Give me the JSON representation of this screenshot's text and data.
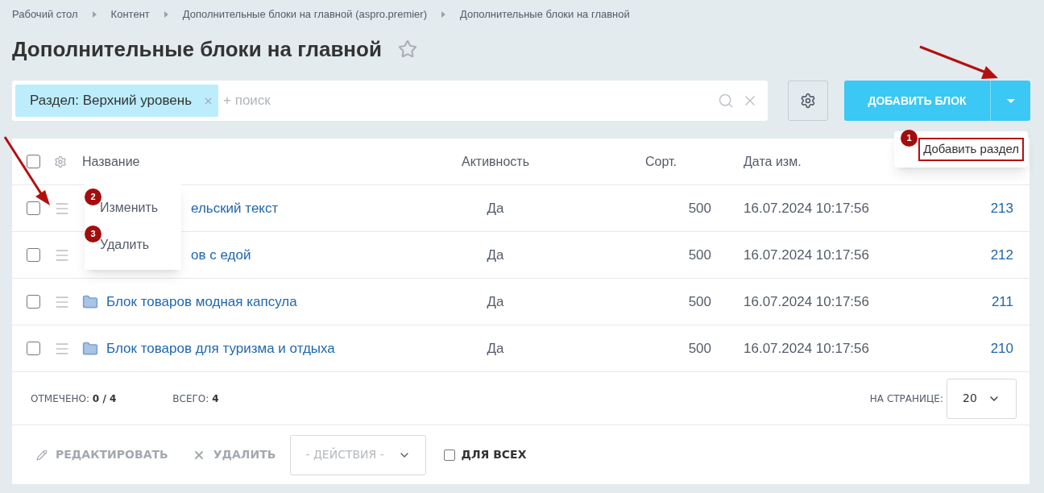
{
  "breadcrumbs": [
    "Рабочий стол",
    "Контент",
    "Дополнительные блоки на главной (aspro.premier)",
    "Дополнительные блоки на главной"
  ],
  "title": "Дополнительные блоки на главной",
  "filter": {
    "tag": "Раздел: Верхний уровень",
    "placeholder": "+ поиск"
  },
  "add_button": {
    "label": "ДОБАВИТЬ БЛОК"
  },
  "dropdown_menu": {
    "badge": "1",
    "items": [
      {
        "label": "Добавить раздел",
        "highlighted": true
      }
    ]
  },
  "table": {
    "select_all_checked": false,
    "columns": [
      "Название",
      "Активность",
      "Сорт.",
      "Дата изм."
    ],
    "rows": [
      {
        "checked": false,
        "folder_visible": false,
        "name": "ельский текст",
        "active": "Да",
        "sort": "500",
        "date": "16.07.2024 10:17:56",
        "id": "213"
      },
      {
        "checked": false,
        "folder_visible": false,
        "name": "ов с едой",
        "active": "Да",
        "sort": "500",
        "date": "16.07.2024 10:17:56",
        "id": "212"
      },
      {
        "checked": false,
        "folder_visible": true,
        "name": "Блок товаров модная капсула",
        "active": "Да",
        "sort": "500",
        "date": "16.07.2024 10:17:56",
        "id": "211"
      },
      {
        "checked": false,
        "folder_visible": true,
        "name": "Блок товаров для туризма и отдыха",
        "active": "Да",
        "sort": "500",
        "date": "16.07.2024 10:17:56",
        "id": "210"
      }
    ]
  },
  "context_menu": {
    "items": [
      {
        "badge": "2",
        "label": "Изменить"
      },
      {
        "badge": "3",
        "label": "Удалить"
      }
    ]
  },
  "footer": {
    "selected_label": "ОТМЕЧЕНО:",
    "selected_value": "0 / 4",
    "total_label": "ВСЕГО:",
    "total_value": "4",
    "per_page_label": "НА СТРАНИЦЕ:",
    "per_page": "20"
  },
  "actions": {
    "edit": "РЕДАКТИРОВАТЬ",
    "delete": "УДАЛИТЬ",
    "select_placeholder": "- ДЕЙСТВИЯ -",
    "for_all": {
      "label": "ДЛЯ ВСЕХ",
      "checked": false
    }
  }
}
